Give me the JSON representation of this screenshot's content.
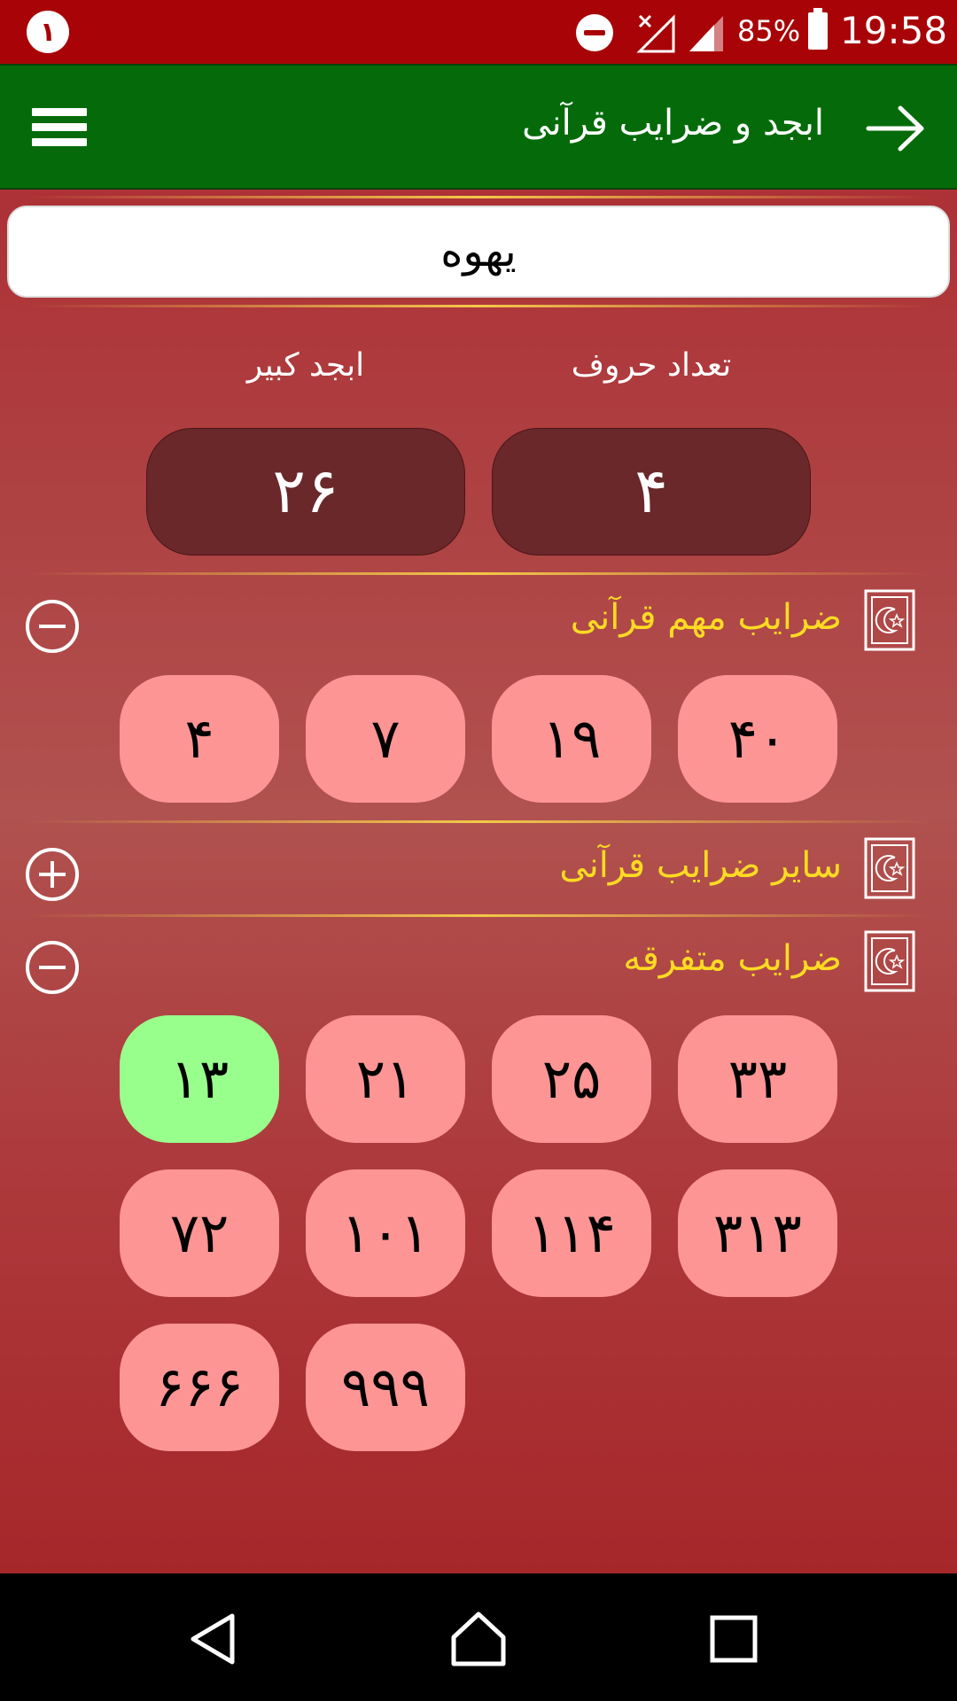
{
  "status_bar": {
    "notification_count": "١",
    "battery": "85%",
    "time": "19:58"
  },
  "app_bar": {
    "title": "ابجد و ضرایب قرآنی"
  },
  "search": {
    "value": "یهوه"
  },
  "results": {
    "letters_label": "تعداد حروف",
    "letters_value": "۴",
    "abjad_label": "ابجد کبیر",
    "abjad_value": "۲۶"
  },
  "sections": {
    "important": {
      "title": "ضرایب مهم قرآنی",
      "items": [
        "۴۰",
        "۱۹",
        "۷",
        "۴"
      ]
    },
    "other": {
      "title": "سایر ضرایب قرآنی"
    },
    "misc": {
      "title": "ضرایب متفرقه",
      "items": [
        "۳۳",
        "۲۵",
        "۲۱",
        "۱۳",
        "۳۱۳",
        "۱۱۴",
        "۱۰۱",
        "۷۲",
        "۹۹۹",
        "۶۶۶"
      ],
      "highlighted": "۱۳"
    }
  },
  "colors": {
    "status_bar": "#a80407",
    "app_bar": "#056b0a",
    "button": "#fd9595",
    "button_highlight": "#99ff8c",
    "result_box": "#6a282a",
    "section_title": "#ffdb22"
  },
  "icons": {
    "menu": "hamburger-menu-icon",
    "back": "arrow-right-icon",
    "section": "quran-book-icon",
    "expand": "plus-circle-icon",
    "collapse": "minus-circle-icon"
  }
}
